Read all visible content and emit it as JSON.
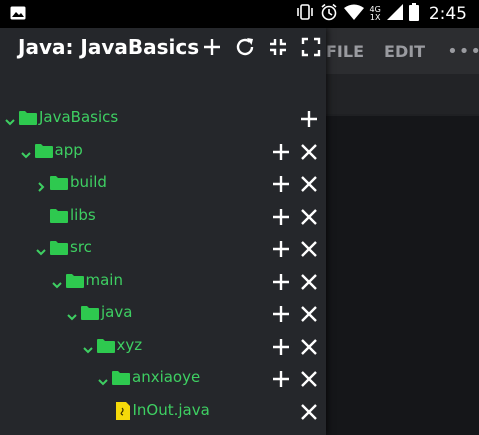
{
  "status_bar": {
    "time": "2:45",
    "network_top": "4G",
    "network_bottom": "1X",
    "icons": [
      "image-icon",
      "vibrate-icon",
      "alarm-icon",
      "wifi-icon",
      "signal-icon",
      "battery-icon"
    ]
  },
  "editor": {
    "menu_file": "FILE",
    "menu_edit": "EDIT",
    "menu_more": "•••"
  },
  "drawer": {
    "title": "Java: JavaBasics",
    "header_icons": [
      "add-icon",
      "refresh-icon",
      "collapse-icon",
      "expand-icon"
    ],
    "tree": [
      {
        "label": "JavaBasics",
        "type": "folder",
        "expanded": true,
        "depth": 0,
        "actions": [
          "add"
        ]
      },
      {
        "label": "app",
        "type": "folder",
        "expanded": true,
        "depth": 1,
        "actions": [
          "add",
          "delete"
        ]
      },
      {
        "label": "build",
        "type": "folder",
        "expanded": false,
        "depth": 2,
        "actions": [
          "add",
          "delete"
        ]
      },
      {
        "label": "libs",
        "type": "folder",
        "expanded": null,
        "depth": 2,
        "actions": [
          "add",
          "delete"
        ]
      },
      {
        "label": "src",
        "type": "folder",
        "expanded": true,
        "depth": 2,
        "actions": [
          "add",
          "delete"
        ]
      },
      {
        "label": "main",
        "type": "folder",
        "expanded": true,
        "depth": 3,
        "actions": [
          "add",
          "delete"
        ]
      },
      {
        "label": "java",
        "type": "folder",
        "expanded": true,
        "depth": 4,
        "actions": [
          "add",
          "delete"
        ]
      },
      {
        "label": "xyz",
        "type": "folder",
        "expanded": true,
        "depth": 5,
        "actions": [
          "add",
          "delete"
        ]
      },
      {
        "label": "anxiaoye",
        "type": "folder",
        "expanded": true,
        "depth": 6,
        "actions": [
          "add",
          "delete"
        ]
      },
      {
        "label": "InOut.java",
        "type": "file",
        "expanded": null,
        "depth": 7,
        "actions": [
          "delete"
        ]
      }
    ]
  },
  "colors": {
    "accent_green": "#3ecf62",
    "folder_green": "#2ec94f",
    "file_yellow": "#f5d90a",
    "drawer_bg": "#25272b"
  }
}
